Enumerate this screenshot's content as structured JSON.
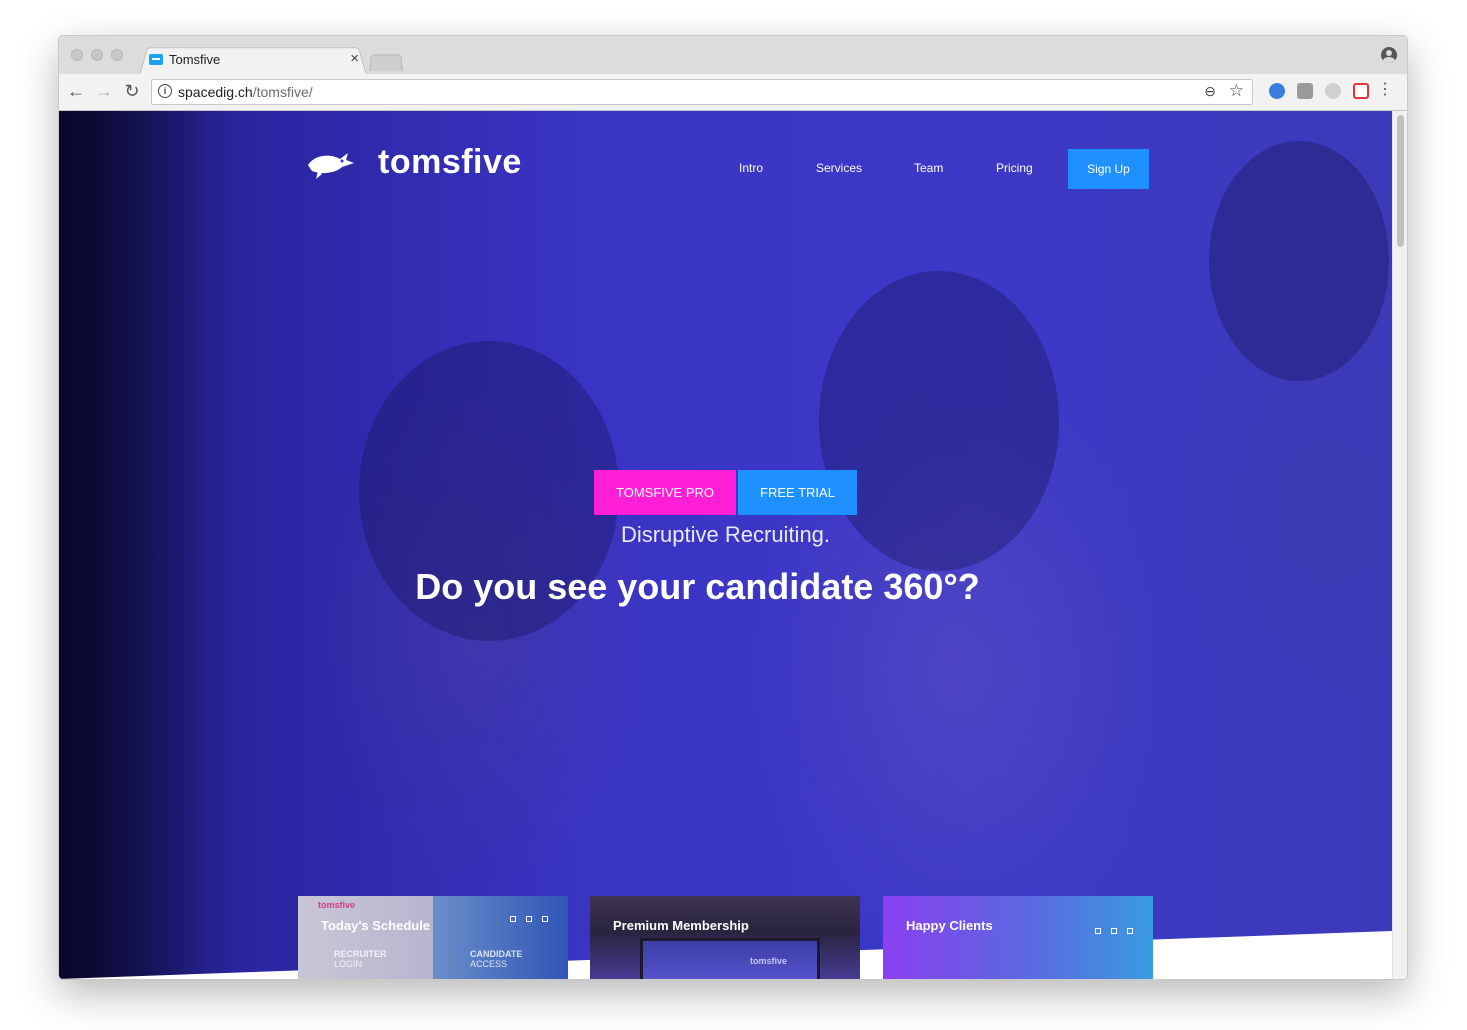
{
  "browser": {
    "tab_title": "Tomsfive",
    "tab_close": "×",
    "url_host": "spacedig.ch",
    "url_path": "/tomsfive/",
    "back": "←",
    "forward": "→",
    "reload": "↻",
    "info": "i",
    "zoom": "⊖",
    "star": "☆",
    "menu": "⋮"
  },
  "site": {
    "logo_text": "tomsfive",
    "nav": [
      "Intro",
      "Services",
      "Team",
      "Pricing"
    ],
    "signup_label": "Sign Up"
  },
  "hero": {
    "btn_pro": "TOMSFIVE PRO",
    "btn_trial": "FREE TRIAL",
    "subtitle": "Disruptive Recruiting.",
    "title": "Do you see your candidate 360°?"
  },
  "cards": [
    {
      "title": "Today's Schedule",
      "mini_logo": "tomsfive",
      "left_label": "RECRUITER",
      "left_sub": "LOGIN",
      "right_label": "CANDIDATE",
      "right_sub": "ACCESS"
    },
    {
      "title": "Premium Membership",
      "mini_logo": "tomsfive"
    },
    {
      "title": "Happy Clients"
    }
  ],
  "colors": {
    "hero_overlay": "#3a34c4",
    "pro_button": "#ff1fd6",
    "trial_button": "#1e90ff",
    "signup_button": "#1e90ff"
  }
}
